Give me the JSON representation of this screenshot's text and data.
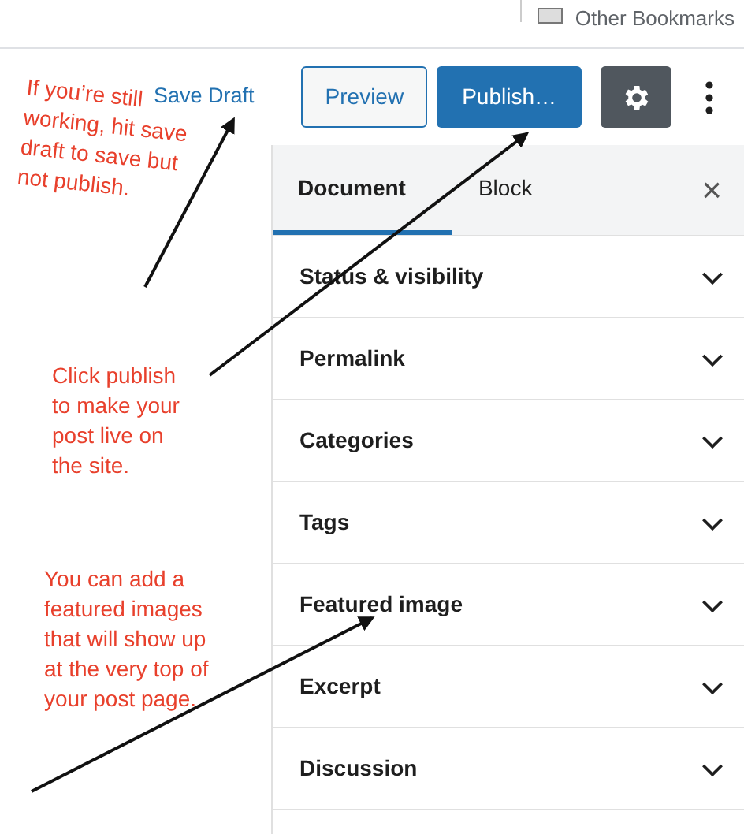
{
  "bookmarks_bar": {
    "label": "Other Bookmarks"
  },
  "header": {
    "save_draft": "Save Draft",
    "preview": "Preview",
    "publish": "Publish…"
  },
  "sidebar": {
    "tabs": [
      {
        "label": "Document",
        "selected": true
      },
      {
        "label": "Block",
        "selected": false
      }
    ],
    "close": "×",
    "panels": [
      {
        "label": "Status & visibility",
        "expanded": false
      },
      {
        "label": "Permalink",
        "expanded": false
      },
      {
        "label": "Categories",
        "expanded": false
      },
      {
        "label": "Tags",
        "expanded": false
      },
      {
        "label": "Featured image",
        "expanded": false
      },
      {
        "label": "Excerpt",
        "expanded": false
      },
      {
        "label": "Discussion",
        "expanded": false
      }
    ]
  },
  "annotations": [
    {
      "lines": [
        "If you’re still",
        "working, hit save",
        "draft to save but",
        "not publish."
      ]
    },
    {
      "lines": [
        "Click publish",
        "to make your",
        "post live on",
        "the site."
      ]
    },
    {
      "lines": [
        "You can add a",
        "featured images",
        "that will show up",
        "at the very top of",
        "your post page."
      ]
    }
  ]
}
